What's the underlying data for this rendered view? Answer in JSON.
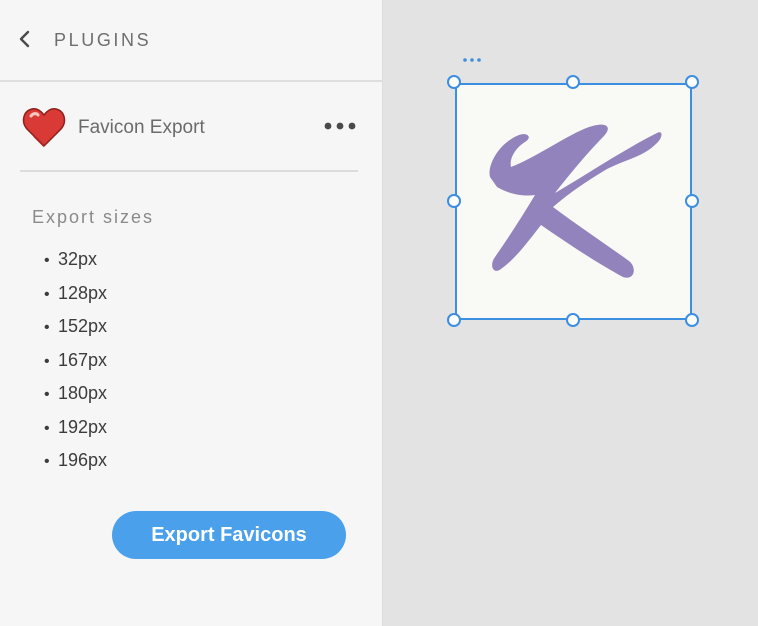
{
  "header": {
    "title": "PLUGINS"
  },
  "plugin": {
    "name": "Favicon Export"
  },
  "section": {
    "title": "Export sizes",
    "sizes": [
      "32px",
      "128px",
      "152px",
      "167px",
      "180px",
      "192px",
      "196px"
    ]
  },
  "button": {
    "label": "Export Favicons"
  },
  "colors": {
    "accent": "#4aa0ea",
    "selection": "#3c8fe0",
    "logo": "#9283bd"
  },
  "icons": {
    "back": "chevron-left-icon",
    "plugin": "heart-icon",
    "more": "more-horizontal-icon",
    "artboard_menu": "ellipsis-icon"
  }
}
